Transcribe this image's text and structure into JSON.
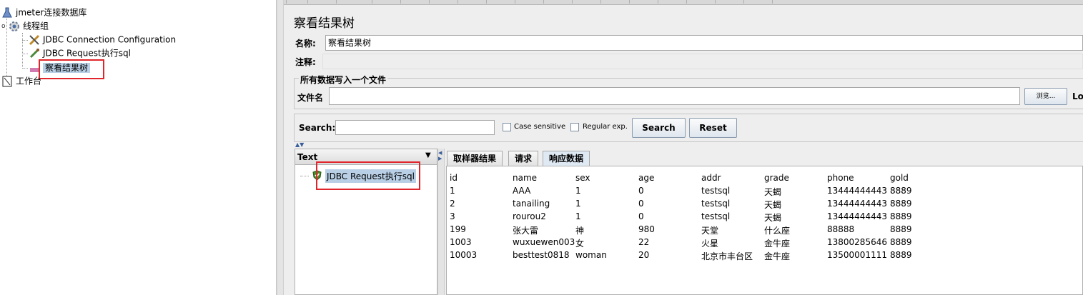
{
  "tree": {
    "root": "jmeter连接数据库",
    "thread_group": "线程组",
    "jdbc_config": "JDBC Connection Configuration",
    "jdbc_request": "JDBC Request执行sql",
    "result_tree": "察看结果树",
    "workbench": "工作台"
  },
  "panel": {
    "title": "察看结果树",
    "name_label": "名称:",
    "name_value": "察看结果树",
    "comment_label": "注释:",
    "comment_value": "",
    "file_group_title": "所有数据写入一个文件",
    "file_label": "文件名",
    "file_value": "",
    "browse_button": "浏览...",
    "log_label_partial": "Lo"
  },
  "search": {
    "label": "Search:",
    "value": "",
    "case_sensitive": "Case sensitive",
    "case_checked": false,
    "regular_exp": "Regular exp.",
    "regex_checked": false,
    "search_button": "Search",
    "reset_button": "Reset"
  },
  "results": {
    "renderer": "Text",
    "samples": [
      "JDBC Request执行sql"
    ],
    "tabs": [
      "取样器结果",
      "请求",
      "响应数据"
    ],
    "active_tab": "响应数据",
    "columns": [
      "id",
      "name",
      "sex",
      "age",
      "addr",
      "grade",
      "phone",
      "gold"
    ],
    "rows": [
      [
        "1",
        "AAA",
        "1",
        "0",
        "testsql",
        "天蝎",
        "13444444443",
        "8889"
      ],
      [
        "2",
        "tanailing",
        "1",
        "0",
        "testsql",
        "天蝎",
        "13444444443",
        "8889"
      ],
      [
        "3",
        "rourou2",
        "1",
        "0",
        "testsql",
        "天蝎",
        "13444444443",
        "8889"
      ],
      [
        "199",
        "张大雷",
        "神",
        "980",
        "天堂",
        "什么座",
        "88888",
        "8889"
      ],
      [
        "1003",
        "wuxuewen003",
        "女",
        "22",
        "火星",
        "金牛座",
        "13800285646",
        "8889"
      ],
      [
        "10003",
        "besttest0818",
        "woman",
        "20",
        "北京市丰台区",
        "金牛座",
        "13500001111",
        "8889"
      ]
    ]
  },
  "colors": {
    "highlight_box": "#e0262c",
    "selection": "#b8cfe5",
    "background": "#eeeeee"
  }
}
